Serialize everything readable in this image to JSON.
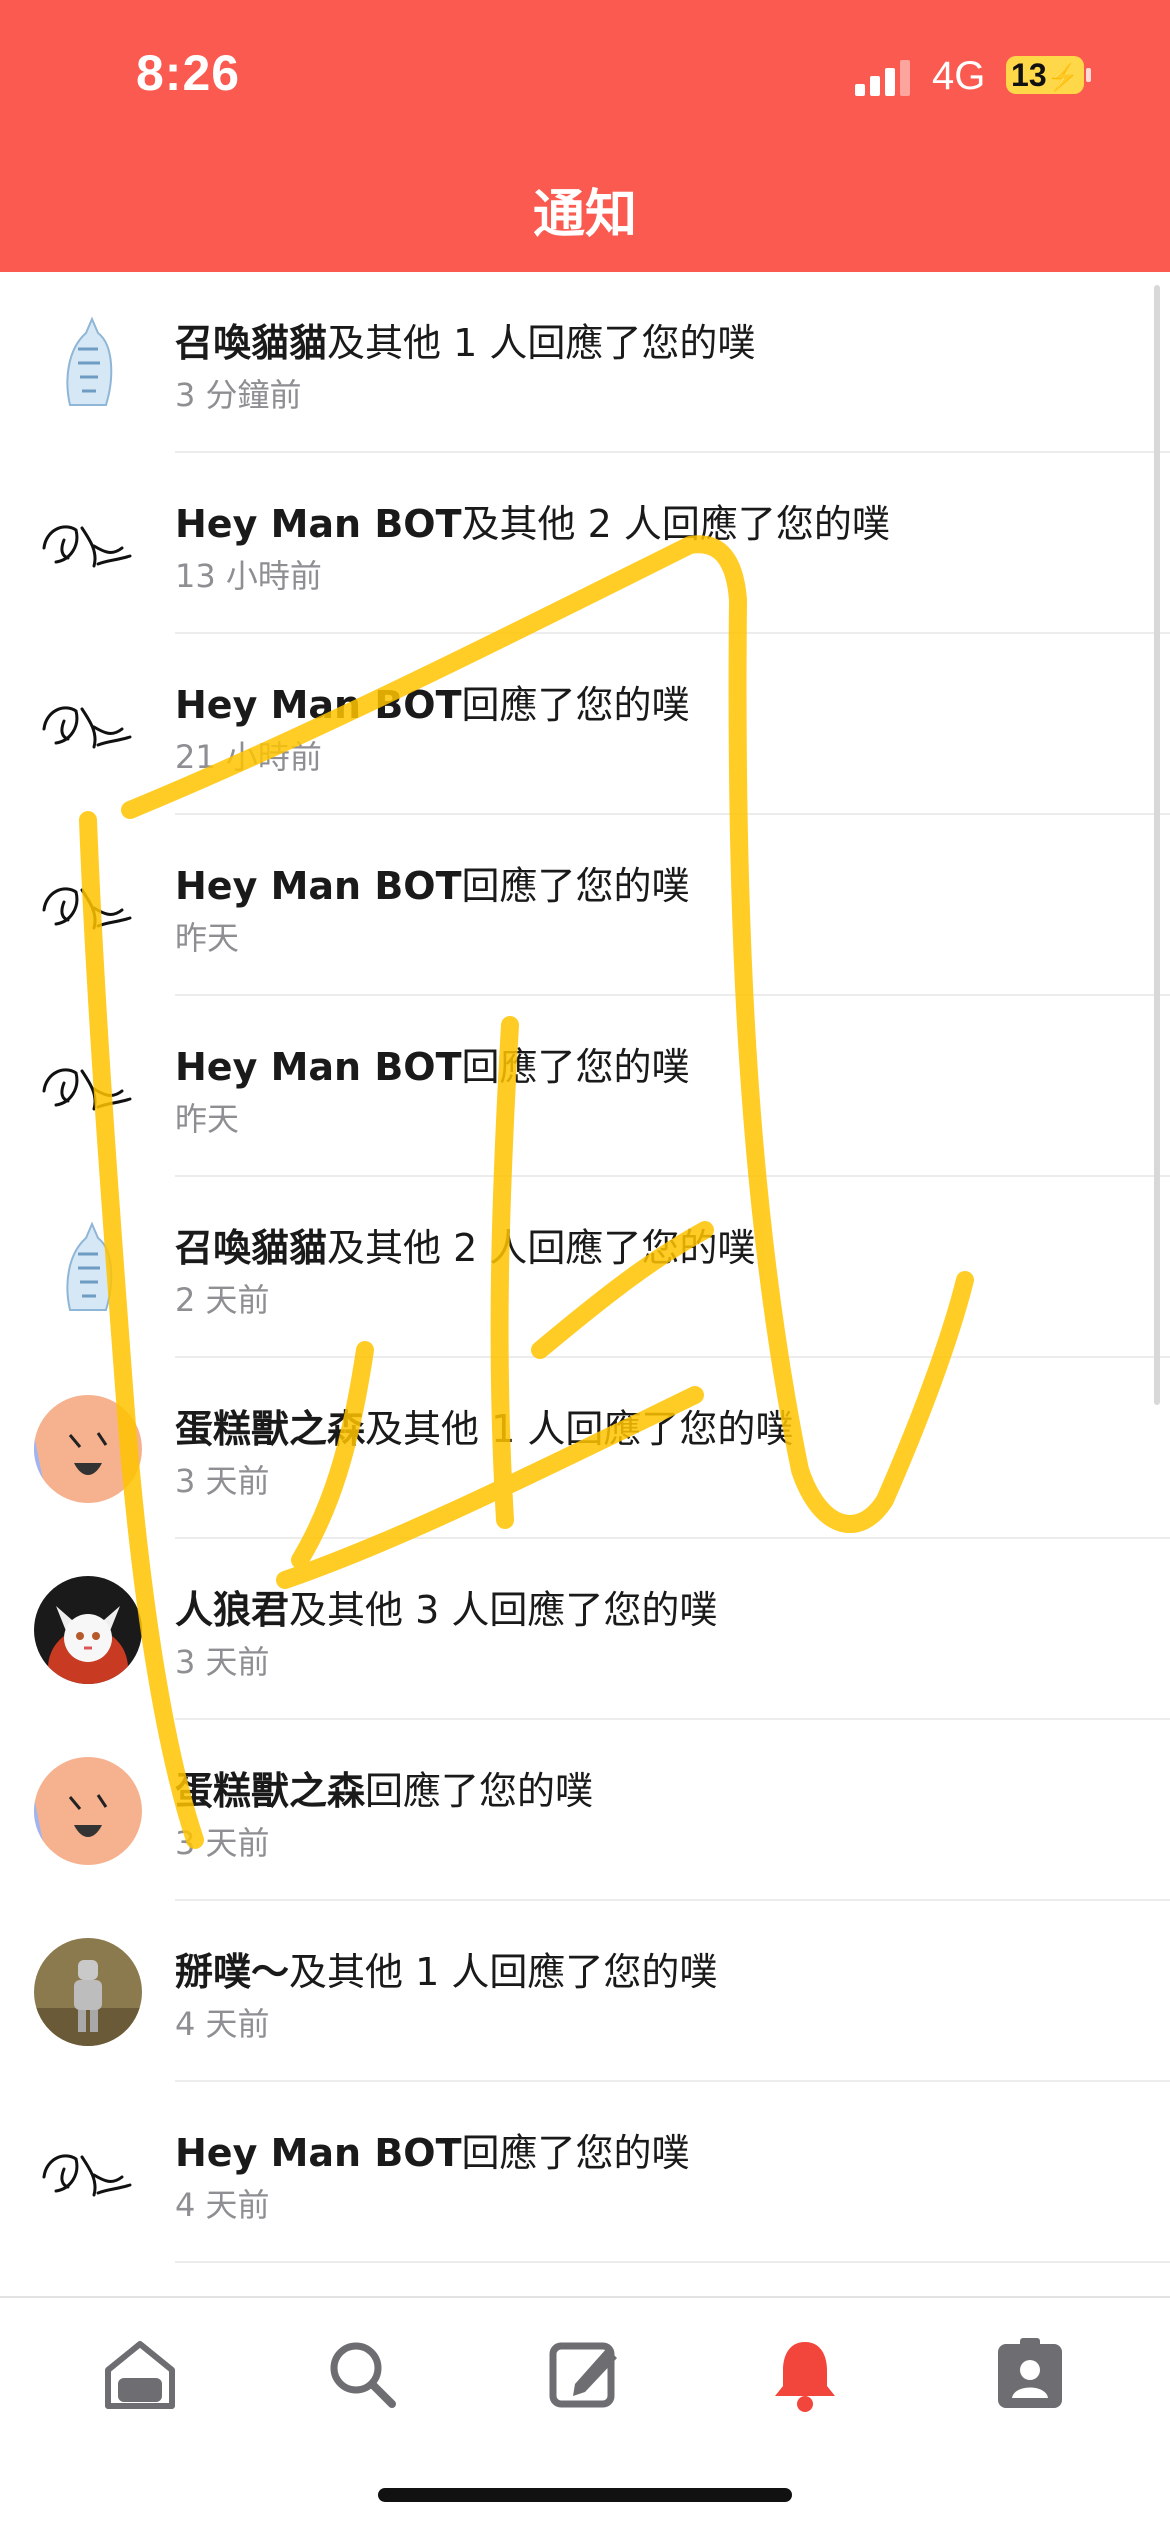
{
  "status_bar": {
    "time": "8:26",
    "network": "4G",
    "battery": "13"
  },
  "header": {
    "title": "通知"
  },
  "notifications": [
    {
      "name": "召喚貓貓",
      "action": "及其他 1 人回應了您的噗",
      "time": "3 分鐘前",
      "avatar": "cat-sketch"
    },
    {
      "name": "Hey Man BOT",
      "action": "及其他 2 人回應了您的噗",
      "time": "13 小時前",
      "avatar": "bot-sketch"
    },
    {
      "name": "Hey Man BOT",
      "action": "回應了您的噗",
      "time": "21 小時前",
      "avatar": "bot-sketch"
    },
    {
      "name": "Hey Man BOT",
      "action": "回應了您的噗",
      "time": "昨天",
      "avatar": "bot-sketch"
    },
    {
      "name": "Hey Man BOT",
      "action": "回應了您的噗",
      "time": "昨天",
      "avatar": "bot-sketch"
    },
    {
      "name": "召喚貓貓",
      "action": "及其他 2 人回應了您的噗",
      "time": "2 天前",
      "avatar": "cat-sketch"
    },
    {
      "name": "蛋糕獸之森",
      "action": "及其他 1 人回應了您的噗",
      "time": "3 天前",
      "avatar": "cake-face"
    },
    {
      "name": "人狼君",
      "action": "及其他 3 人回應了您的噗",
      "time": "3 天前",
      "avatar": "wolf-face"
    },
    {
      "name": "蛋糕獸之森",
      "action": "回應了您的噗",
      "time": "3 天前",
      "avatar": "cake-face"
    },
    {
      "name": "掰噗～",
      "action": "及其他 1 人回應了您的噗",
      "time": "4 天前",
      "avatar": "knight-photo"
    },
    {
      "name": "Hey Man BOT",
      "action": "回應了您的噗",
      "time": "4 天前",
      "avatar": "bot-sketch"
    }
  ],
  "tabbar": {
    "items": [
      {
        "icon": "home-icon",
        "active": false
      },
      {
        "icon": "search-icon",
        "active": false
      },
      {
        "icon": "compose-icon",
        "active": false
      },
      {
        "icon": "bell-icon",
        "active": true
      },
      {
        "icon": "profile-card-icon",
        "active": false
      }
    ]
  },
  "colors": {
    "brand": "#fa5a4f",
    "active_tab": "#f2463c",
    "inactive_tab": "#6d6d72",
    "scribble": "#ffc400"
  }
}
